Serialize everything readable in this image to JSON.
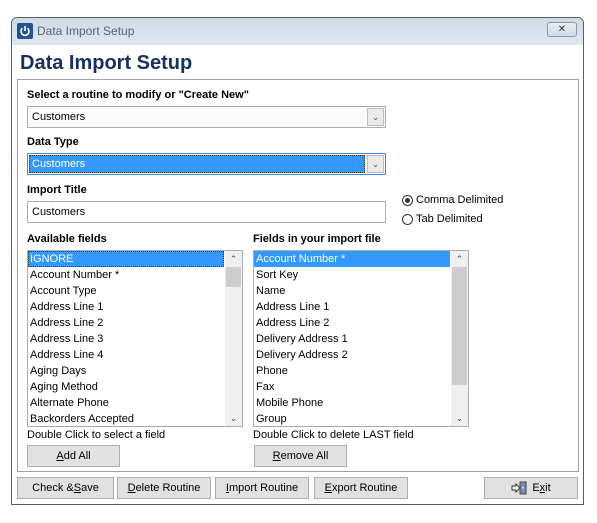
{
  "window": {
    "title": "Data Import Setup",
    "close_glyph": "✕"
  },
  "header": {
    "title": "Data Import Setup"
  },
  "routine": {
    "label": "Select a routine to modify or \"Create New\"",
    "selected": "Customers"
  },
  "data_type": {
    "label": "Data Type",
    "selected": "Customers"
  },
  "import_title": {
    "label": "Import Title",
    "value": "Customers"
  },
  "delimiter": {
    "options": [
      {
        "label": "Comma Delimited",
        "checked": true
      },
      {
        "label": "Tab Delimited",
        "checked": false
      }
    ]
  },
  "available_fields": {
    "label": "Available fields",
    "selected_index": 0,
    "items": [
      "IGNORE",
      "Account Number *",
      "Account Type",
      "Address Line 1",
      "Address Line 2",
      "Address Line 3",
      "Address Line 4",
      "Aging Days",
      "Aging Method",
      "Alternate Phone",
      "Backorders Accepted"
    ],
    "hint": "Double Click to select a field",
    "button": {
      "pre": "",
      "mnemonic": "A",
      "post": "dd All"
    }
  },
  "import_fields": {
    "label": "Fields in your import file",
    "selected_index": 0,
    "items": [
      "Account Number *",
      "Sort Key",
      "Name",
      "Address Line 1",
      "Address Line 2",
      "Delivery Address 1",
      "Delivery Address 2",
      "Phone",
      "Fax",
      "Mobile Phone",
      "Group"
    ],
    "hint": "Double Click to delete LAST field",
    "button": {
      "pre": "",
      "mnemonic": "R",
      "post": "emove All"
    }
  },
  "footer": {
    "check_save": {
      "pre": "Check & ",
      "mnemonic": "S",
      "post": "ave"
    },
    "delete_routine": {
      "pre": "",
      "mnemonic": "D",
      "post": "elete Routine"
    },
    "import_routine": {
      "pre": "",
      "mnemonic": "I",
      "post": "mport Routine"
    },
    "export_routine": {
      "pre": "",
      "mnemonic": "E",
      "post": "xport Routine"
    },
    "exit": {
      "pre": "E",
      "mnemonic": "x",
      "post": "it"
    }
  },
  "colors": {
    "title_text": "#18305e",
    "selection": "#3399ff"
  }
}
